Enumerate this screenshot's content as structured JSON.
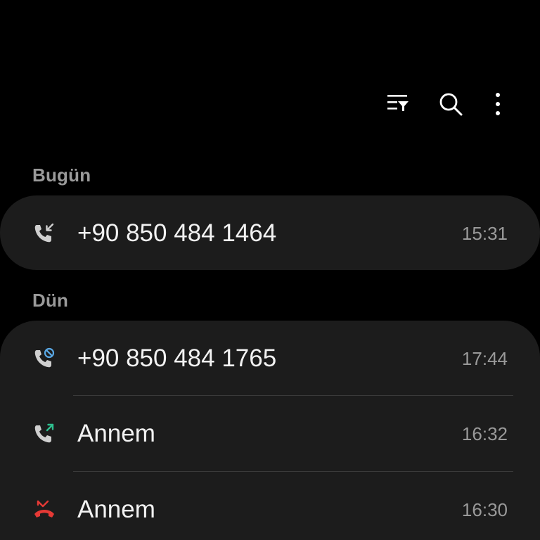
{
  "toolbar": {
    "filter_icon": "filter-list-icon",
    "search_icon": "search-icon",
    "more_icon": "more-vertical-icon"
  },
  "sections": [
    {
      "header": "Bugün",
      "calls": [
        {
          "name": "+90 850 484 1464",
          "time": "15:31",
          "type": "incoming",
          "icon": "incoming-call-icon"
        }
      ]
    },
    {
      "header": "Dün",
      "calls": [
        {
          "name": "+90 850 484 1765",
          "time": "17:44",
          "type": "blocked",
          "icon": "blocked-call-icon"
        },
        {
          "name": "Annem",
          "time": "16:32",
          "type": "outgoing",
          "icon": "outgoing-call-icon"
        },
        {
          "name": "Annem",
          "time": "16:30",
          "type": "missed",
          "icon": "missed-call-icon"
        }
      ]
    }
  ],
  "colors": {
    "background": "#000000",
    "card": "#1c1c1c",
    "primary_text": "#f2f2f2",
    "secondary_text": "#9a9a9a",
    "icon_gray": "#cfcfcf",
    "blocked_accent": "#5aa9e6",
    "outgoing_accent": "#2fbf8f",
    "missed_accent": "#e53935"
  }
}
